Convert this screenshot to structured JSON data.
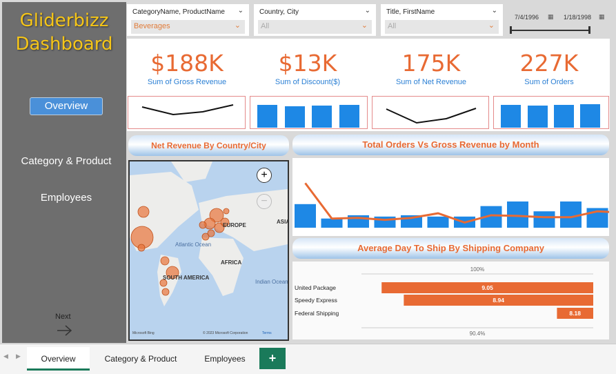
{
  "app": {
    "logo_line1": "Gliderbizz",
    "logo_line2": "Dashboard"
  },
  "nav": {
    "overview": "Overview",
    "category_product": "Category & Product",
    "employees": "Employees",
    "next": "Next"
  },
  "slicers": [
    {
      "title": "CategoryName, ProductName",
      "value": "Beverages"
    },
    {
      "title": "Country, City",
      "value": "All"
    },
    {
      "title": "Title, FirstName",
      "value": "All"
    }
  ],
  "date_slicer": {
    "start": "7/4/1996",
    "end": "1/18/1998"
  },
  "kpis": [
    {
      "value": "$188K",
      "label": "Sum of Gross Revenue"
    },
    {
      "value": "$13K",
      "label": "Sum of Discount($)"
    },
    {
      "value": "175K",
      "label": "Sum of Net Revenue"
    },
    {
      "value": "227K",
      "label": "Sum of Orders"
    }
  ],
  "map": {
    "title": "Net Revenue By Country/City",
    "labels": {
      "europe": "EUROPE",
      "asia": "ASIA",
      "africa": "AFRICA",
      "south_america": "SOUTH AMERICA",
      "atlantic": "Atlantic Ocean",
      "indian": "Indian Ocean"
    },
    "credit_left": "Microsoft Bing",
    "credit_mid": "© 2023 Microsoft Corporation",
    "credit_right": "Terms"
  },
  "combo": {
    "title": "Total Orders Vs Gross Revenue by Month"
  },
  "ship": {
    "title": "Average Day To Ship By Shipping Company",
    "top_ref": "100%",
    "bottom_ref": "90.4%"
  },
  "tabs": {
    "t1": "Overview",
    "t2": "Category & Product",
    "t3": "Employees",
    "add": "+"
  },
  "chart_data": [
    {
      "type": "bar",
      "title": "Average Day To Ship By Shipping Company",
      "categories": [
        "United Package",
        "Speedy Express",
        "Federal Shipping"
      ],
      "values": [
        9.05,
        8.94,
        8.18
      ],
      "value_labels": [
        "9.05",
        "8.94",
        "8.18"
      ],
      "colors": {
        "bar": "#e86a33"
      }
    },
    {
      "type": "bar",
      "title": "Total Orders Vs Gross Revenue by Month",
      "series": [
        {
          "values": [
            36,
            14,
            19,
            17,
            19,
            17,
            17,
            33,
            40,
            25,
            40,
            30,
            40
          ]
        },
        {
          "values": [
            68,
            14,
            15,
            12,
            15,
            22,
            8,
            19,
            18,
            16,
            16,
            25,
            23
          ]
        }
      ],
      "colors": {
        "bars": "#1e88e5",
        "line": "#e86a33"
      }
    }
  ]
}
